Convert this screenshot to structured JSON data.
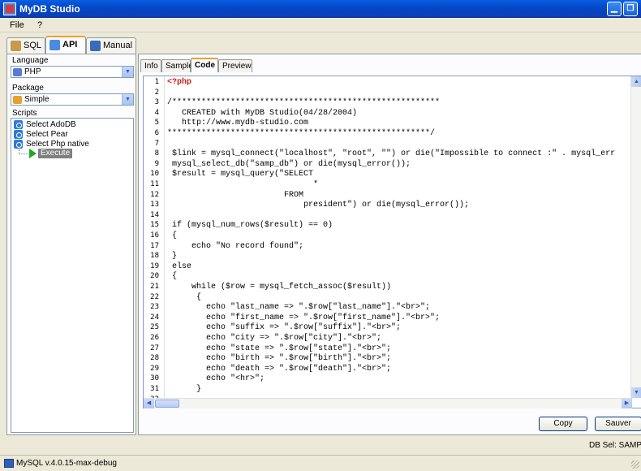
{
  "window": {
    "title": "MyDB Studio",
    "min_glyph": "▁",
    "max_glyph": "❐"
  },
  "menu": {
    "file": "File",
    "help": "?"
  },
  "top_tabs": {
    "sql": "SQL",
    "api": "API",
    "manual": "Manual"
  },
  "left_panel": {
    "language_label": "Language",
    "language_value": "PHP",
    "package_label": "Package",
    "package_value": "Simple",
    "scripts_label": "Scripts",
    "scripts": [
      "Select AdoDB",
      "Select Pear",
      "Select Php native"
    ],
    "execute_label": "Execute"
  },
  "sub_tabs": {
    "info": "Info",
    "sample": "Sample",
    "code": "Code",
    "preview": "Preview"
  },
  "code_lines": [
    "<?php",
    "",
    "/*******************************************************",
    "   CREATED with MyDB Studio(04/28/2004)",
    "   http://www.mydb-studio.com",
    "******************************************************/",
    "",
    " $link = mysql_connect(\"localhost\", \"root\", \"\") or die(\"Impossible to connect :\" . mysql_err",
    " mysql_select_db(\"samp_db\") or die(mysql_error());",
    " $result = mysql_query(\"SELECT",
    "                              *",
    "                        FROM",
    "                            president\") or die(mysql_error());",
    "",
    " if (mysql_num_rows($result) == 0)",
    " {",
    "     echo \"No record found\";",
    " }",
    " else",
    " {",
    "     while ($row = mysql_fetch_assoc($result))",
    "      {",
    "        echo \"last_name => \".$row[\"last_name\"].\"<br>\";",
    "        echo \"first_name => \".$row[\"first_name\"].\"<br>\";",
    "        echo \"suffix => \".$row[\"suffix\"].\"<br>\";",
    "        echo \"city => \".$row[\"city\"].\"<br>\";",
    "        echo \"state => \".$row[\"state\"].\"<br>\";",
    "        echo \"birth => \".$row[\"birth\"].\"<br>\";",
    "        echo \"death => \".$row[\"death\"].\"<br>\";",
    "        echo \"<hr>\";",
    "      }",
    ""
  ],
  "buttons": {
    "copy": "Copy",
    "save": "Sauver"
  },
  "db_sel": "DB Sel: SAMP_I",
  "status_text": "MySQL v.4.0.15-max-debug",
  "colors": {
    "titlebar": "#0a5ee0",
    "php_tag": "#d02020",
    "execute_highlight": "#808080"
  }
}
